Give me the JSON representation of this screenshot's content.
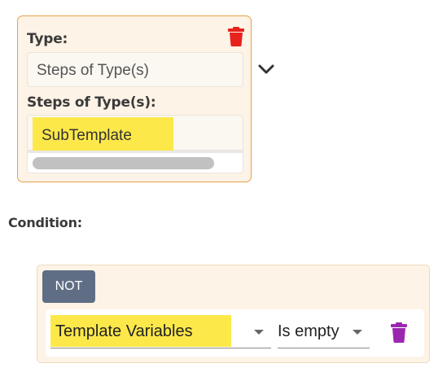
{
  "type_card": {
    "type_label": "Type:",
    "type_value": "Steps of Type(s)",
    "steps_label": "Steps of Type(s):",
    "selected_chip": "SubTemplate",
    "delete_icon": "trash-icon",
    "expand_icon": "chevron-down-icon"
  },
  "condition": {
    "label": "Condition:",
    "not_label": "NOT",
    "rule": {
      "field": "Template Variables",
      "operator": "Is empty",
      "delete_icon": "trash-icon"
    }
  },
  "colors": {
    "card_border": "#e6a04a",
    "card_bg": "#fdf3e6",
    "highlight": "#fde84a",
    "not_button": "#5f6e85",
    "trash_red": "#e8211c",
    "trash_purple": "#9b27b0"
  }
}
